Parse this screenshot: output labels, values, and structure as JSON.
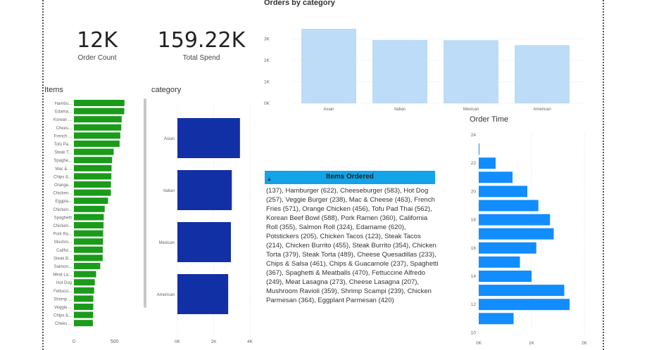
{
  "kpis": [
    {
      "value": "12K",
      "label": "Order Count"
    },
    {
      "value": "159.22K",
      "label": "Total Spend"
    }
  ],
  "items_chart": {
    "title": "Items",
    "type": "bar",
    "color": "#1a9c1a",
    "categories": [
      "Hambu...",
      "Edama...",
      "Korean ...",
      "Chees...",
      "French ...",
      "Tofu Pa...",
      "Steak T...",
      "Spaghe...",
      "Mac & ...",
      "Chips &...",
      "Orange...",
      "Chicken...",
      "Eggpla...",
      "Chicken...",
      "Spaghetti",
      "Chicken...",
      "Pork Ra...",
      "Mushro...",
      "Califor...",
      "Steak B...",
      "Salmon...",
      "Meat La...",
      "Hot Dog",
      "Fettucci...",
      "Shrimp ...",
      "Veggie ...",
      "Chips &...",
      "Chees ..."
    ],
    "values": [
      622,
      620,
      588,
      583,
      571,
      562,
      489,
      470,
      463,
      461,
      456,
      455,
      420,
      379,
      367,
      364,
      360,
      359,
      355,
      354,
      324,
      273,
      257,
      249,
      239,
      238,
      237,
      233
    ],
    "tick_labels": [
      "0",
      "500"
    ],
    "xlim": [
      0,
      650
    ]
  },
  "category_chart": {
    "title": "category",
    "type": "bar",
    "color": "#1230a6",
    "categories": [
      "Asian",
      "Italian",
      "Mexican",
      "American"
    ],
    "values": [
      3450,
      3000,
      2950,
      2800
    ],
    "tick_labels": [
      "0K",
      "2K",
      "4K"
    ],
    "xlim": [
      0,
      4000
    ]
  },
  "orders_by_category": {
    "title": "Orders by category",
    "type": "bar",
    "color": "#bcdcf7",
    "categories": [
      "Asian",
      "Italian",
      "Mexican",
      "American"
    ],
    "values": [
      3470,
      2950,
      2940,
      2710
    ],
    "tick_labels": [
      "0K",
      "1K",
      "2K",
      "3K"
    ],
    "ylim": [
      0,
      3600
    ]
  },
  "order_time": {
    "title": "Order Time",
    "type": "bar",
    "color": "#118dff",
    "categories": [
      23,
      22,
      21,
      20,
      19,
      18,
      17,
      16,
      15,
      14,
      13,
      12,
      11
    ],
    "values": [
      5,
      320,
      640,
      920,
      1130,
      1350,
      1420,
      1090,
      780,
      1000,
      1620,
      1720,
      660
    ],
    "tick_labels_y": [
      "24",
      "22",
      "20",
      "18",
      "16",
      "14",
      "12",
      "10"
    ],
    "tick_labels_x": [
      "0K",
      "1K",
      "2K"
    ],
    "xlim": [
      0,
      2000
    ]
  },
  "items_ordered": {
    "header": "Items Ordered",
    "text": "(137), Hamburger (622), Cheeseburger (583), Hot Dog (257), Veggie Burger (238), Mac & Cheese (463), French Fries (571), Orange Chicken (456), Tofu Pad Thai (562), Korean Beef Bowl (588), Pork Ramen (360), California Roll (355), Salmon Roll (324), Edamame (620), Potstickers (205), Chicken Tacos (123), Steak Tacos (214), Chicken Burrito (455), Steak Burrito (354), Chicken Torta (379), Steak Torta (489), Cheese Quesadillas (233), Chips & Salsa (461), Chips & Guacamole (237), Spaghetti (367), Spaghetti & Meatballs (470), Fettuccine Alfredo (249), Meat Lasagna (273), Cheese Lasagna (207), Mushroom Ravioli (359), Shrimp Scampi (239), Chicken Parmesan (364), Eggplant Parmesan (420)"
  }
}
